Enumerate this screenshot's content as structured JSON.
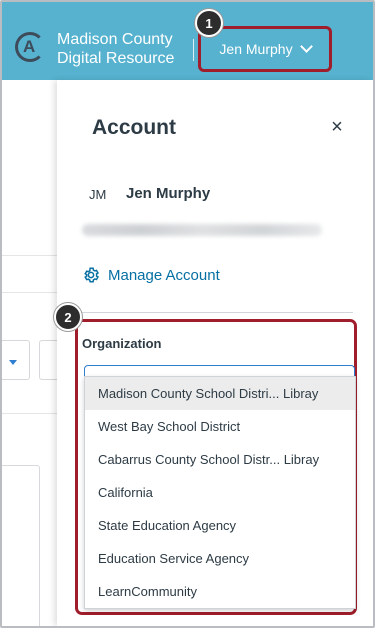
{
  "header": {
    "org_name_line1": "Madison County",
    "org_name_line2": "Digital Resource",
    "logo_letter": "A",
    "user_button_label": "Jen Murphy",
    "brand_color": "#56b2cf"
  },
  "callouts": [
    "1",
    "2"
  ],
  "account_panel": {
    "title": "Account",
    "close_symbol": "×",
    "initials": "JM",
    "user_name": "Jen Murphy",
    "manage_account_label": "Manage Account",
    "organization_label": "Organization",
    "organizations": [
      "Madison County School Distri... Libray",
      "West Bay School District",
      "Cabarrus County School Distr... Libray",
      "California",
      "State Education Agency",
      "Education Service Agency",
      "LearnCommunity"
    ],
    "highlight_color": "#a01e2b",
    "link_color": "#0770a3"
  }
}
